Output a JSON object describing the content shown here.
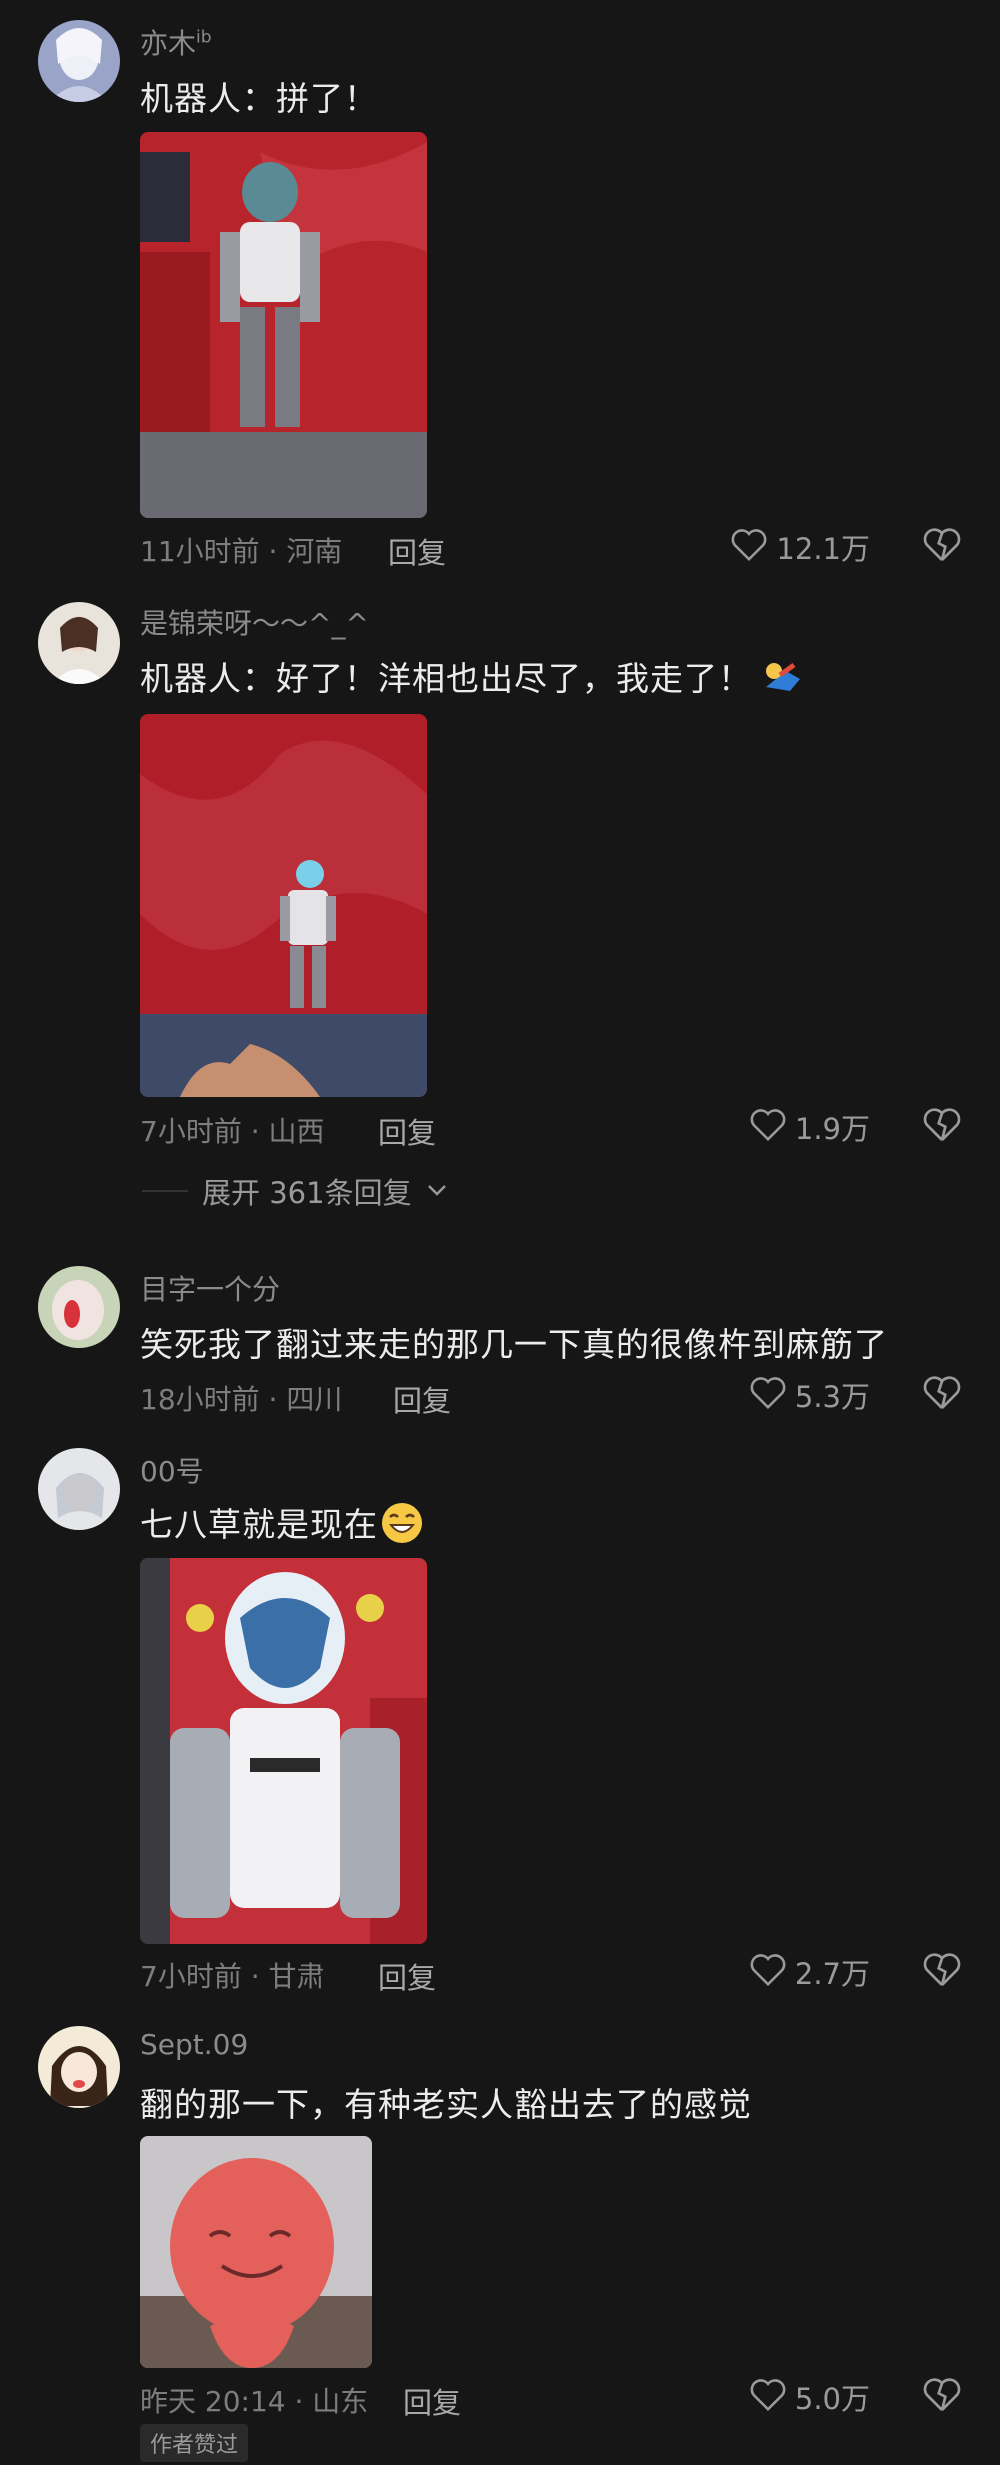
{
  "colors": {
    "background": "#161616",
    "primary_text": "#ececec",
    "secondary_text": "#8b8b8b"
  },
  "comments": [
    {
      "username": "亦木",
      "username_badge": "ib",
      "text": "机器人：拼了！",
      "time_location": "11小时前 · 河南",
      "reply_label": "回复",
      "likes": "12.1万"
    },
    {
      "username": "是锦荣呀～～^_^",
      "text": "机器人：好了！洋相也出尽了，我走了！",
      "time_location": "7小时前 · 山西",
      "reply_label": "回复",
      "likes": "1.9万",
      "expand_label": "展开 361条回复"
    },
    {
      "username": "目字一个分",
      "text": "笑死我了翻过来走的那几一下真的很像杵到麻筋了",
      "time_location": "18小时前 · 四川",
      "reply_label": "回复",
      "likes": "5.3万"
    },
    {
      "username": "00号",
      "text": "七八草就是现在",
      "time_location": "7小时前 · 甘肃",
      "reply_label": "回复",
      "likes": "2.7万"
    },
    {
      "username": "Sept.09",
      "text": "翻的那一下，有种老实人豁出去了的感觉",
      "time_location": "昨天 20:14 · 山东",
      "reply_label": "回复",
      "likes": "5.0万",
      "author_badge": "作者赞过"
    }
  ]
}
